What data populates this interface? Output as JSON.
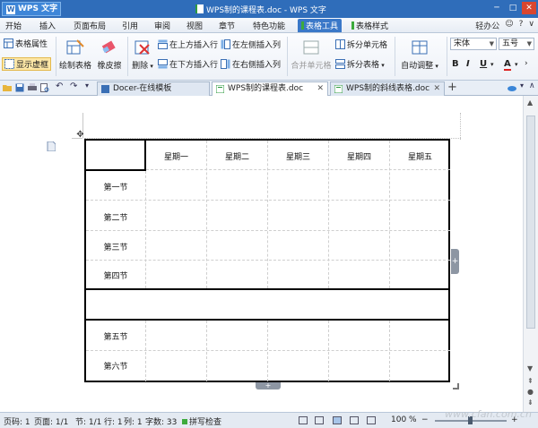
{
  "titlebar": {
    "app_button": "WPS 文字",
    "app_logo_letter": "W",
    "title": "WPS制的课程表.doc - WPS 文字",
    "minimize": "─",
    "maximize": "□",
    "close": "✕"
  },
  "menu": {
    "tabs": [
      "开始",
      "插入",
      "页面布局",
      "引用",
      "审阅",
      "视图",
      "章节",
      "特色功能",
      "表格工具",
      "表格样式"
    ],
    "active": "表格工具",
    "right": [
      "轻办公",
      "☺",
      "?",
      "∨"
    ]
  },
  "ribbon": {
    "table_props": "表格属性",
    "show_grid": "显示虚框",
    "draw_table": "绘制表格",
    "eraser": "橡皮擦",
    "delete": "删除",
    "insert_above": "在上方插入行",
    "insert_below": "在下方插入行",
    "insert_left": "在左侧插入列",
    "insert_right": "在右侧插入列",
    "merge_cells": "合并单元格",
    "split_cells": "拆分单元格",
    "split_table": "拆分表格",
    "auto_fit": "自动调整",
    "font_name": "宋体",
    "font_size": "五号",
    "bold": "B",
    "italic": "I",
    "underline": "U",
    "font_color": "A"
  },
  "doc_tabs": [
    {
      "label": "Docer-在线模板",
      "active": false
    },
    {
      "label": "WPS制的课程表.doc",
      "active": true
    },
    {
      "label": "WPS制的斜线表格.doc",
      "active": false
    }
  ],
  "table": {
    "days": [
      "星期一",
      "星期二",
      "星期三",
      "星期四",
      "星期五"
    ],
    "periods_morning": [
      "第一节",
      "第二节",
      "第三节",
      "第四节"
    ],
    "periods_afternoon": [
      "第五节",
      "第六节"
    ]
  },
  "statusbar": {
    "page": "页码: 1",
    "pages": "页面: 1/1",
    "section": "节: 1/1",
    "row": "行: 1",
    "col": "列: 1",
    "words": "字数: 33",
    "spell": "拼写检查",
    "zoom": "100 %"
  },
  "watermark": "www.cfan.com.cn"
}
